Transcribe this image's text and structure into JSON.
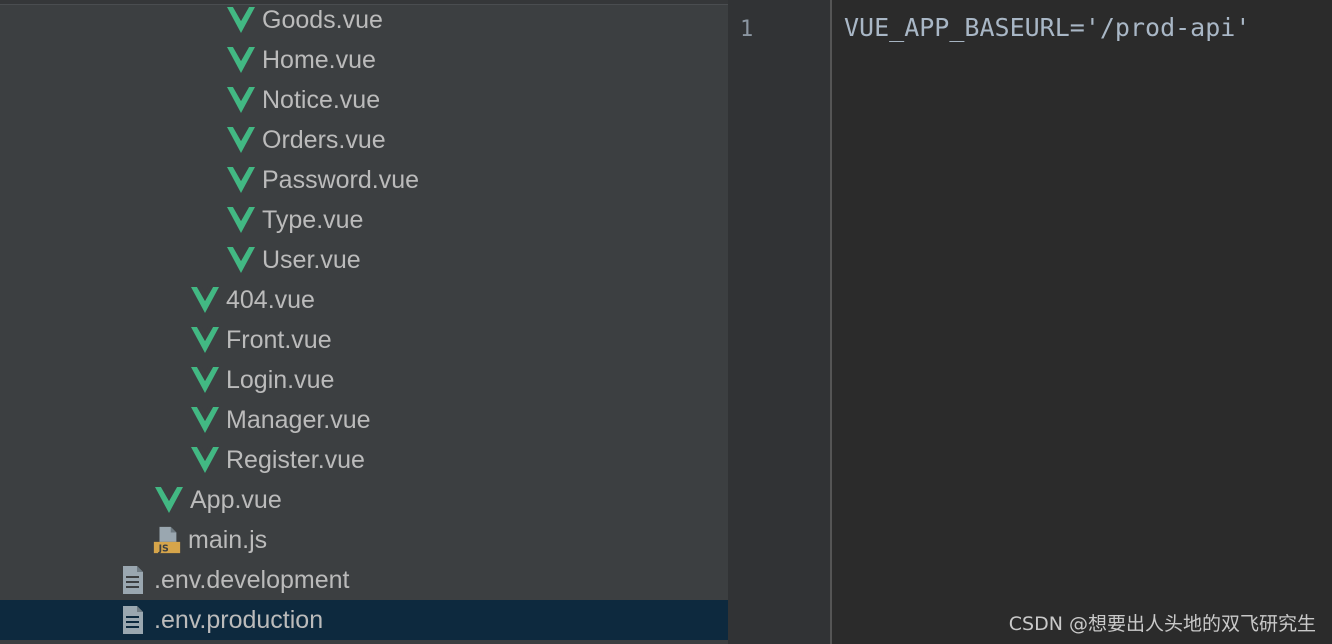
{
  "project_tree": {
    "items": [
      {
        "label": "Goods.vue",
        "icon": "vue-icon"
      },
      {
        "label": "Home.vue",
        "icon": "vue-icon"
      },
      {
        "label": "Notice.vue",
        "icon": "vue-icon"
      },
      {
        "label": "Orders.vue",
        "icon": "vue-icon"
      },
      {
        "label": "Password.vue",
        "icon": "vue-icon"
      },
      {
        "label": "Type.vue",
        "icon": "vue-icon"
      },
      {
        "label": "User.vue",
        "icon": "vue-icon"
      },
      {
        "label": "404.vue",
        "icon": "vue-icon"
      },
      {
        "label": "Front.vue",
        "icon": "vue-icon"
      },
      {
        "label": "Login.vue",
        "icon": "vue-icon"
      },
      {
        "label": "Manager.vue",
        "icon": "vue-icon"
      },
      {
        "label": "Register.vue",
        "icon": "vue-icon"
      },
      {
        "label": "App.vue",
        "icon": "vue-icon"
      },
      {
        "label": "main.js",
        "icon": "js-file-icon"
      },
      {
        "label": ".env.development",
        "icon": "text-file-icon"
      },
      {
        "label": ".env.production",
        "icon": "text-file-icon",
        "selected": true
      }
    ]
  },
  "editor": {
    "line_numbers": [
      "1"
    ],
    "lines": [
      "VUE_APP_BASEURL='/prod-api'"
    ]
  },
  "watermark": "CSDN @想要出人头地的双飞研究生",
  "colors": {
    "vue_green": "#42b883",
    "vue_dark": "#35495e",
    "js_badge": "#d6a54a",
    "selection": "#0d293e"
  }
}
